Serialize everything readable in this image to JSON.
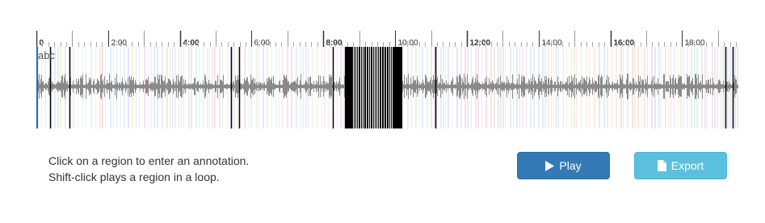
{
  "timeline": {
    "ticks": [
      {
        "label": "0",
        "bold": true
      },
      {
        "label": "2:00",
        "bold": false
      },
      {
        "label": "4:00",
        "bold": true
      },
      {
        "label": "6:00",
        "bold": false
      },
      {
        "label": "8:00",
        "bold": true
      },
      {
        "label": "10:00",
        "bold": false
      },
      {
        "label": "12:00",
        "bold": true
      },
      {
        "label": "14:00",
        "bold": false
      },
      {
        "label": "16:00",
        "bold": true
      },
      {
        "label": "18:00",
        "bold": false
      }
    ],
    "total_seconds": 1174
  },
  "waveform": {
    "wave_color": "#8a8a8a",
    "cursor_color": "#1f6fb5",
    "region_label": "abc",
    "marker_times": [
      23,
      55,
      325,
      339,
      496,
      668,
      1152,
      1165
    ],
    "dense_band": [
      516,
      612
    ]
  },
  "help": {
    "line1": "Click on a region to enter an annotation.",
    "line2": "Shift-click plays a region in a loop."
  },
  "buttons": {
    "play_label": "Play",
    "export_label": "Export",
    "play_icon": "play-icon",
    "export_icon": "file-icon",
    "play_color": "#337ab7",
    "export_color": "#5bc0de"
  }
}
